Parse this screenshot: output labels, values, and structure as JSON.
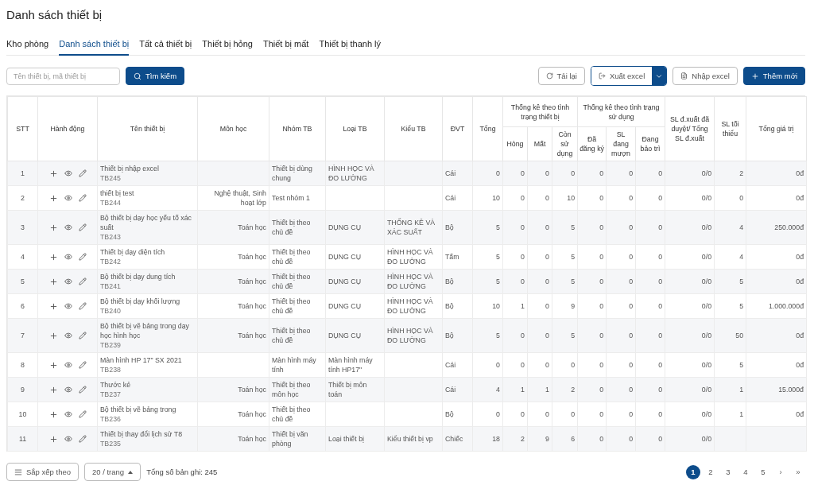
{
  "page_title": "Danh sách thiết bị",
  "tabs": [
    {
      "label": "Kho phòng",
      "selected": false
    },
    {
      "label": "Danh sách thiết bị",
      "selected": true
    },
    {
      "label": "Tất cả thiết bị",
      "selected": false
    },
    {
      "label": "Thiết bị hỏng",
      "selected": false
    },
    {
      "label": "Thiết bị mất",
      "selected": false
    },
    {
      "label": "Thiết bị thanh lý",
      "selected": false
    }
  ],
  "search": {
    "placeholder": "Tên thiết bị, mã thiết bị",
    "button": "Tìm kiếm"
  },
  "actions": {
    "reload": "Tải lại",
    "export": "Xuất excel",
    "import": "Nhập excel",
    "add": "Thêm mới"
  },
  "table": {
    "columns": [
      {
        "label": "STT"
      },
      {
        "label": "Hành động"
      },
      {
        "label": "Tên thiết bị"
      },
      {
        "label": "Môn học"
      },
      {
        "label": "Nhóm TB"
      },
      {
        "label": "Loại TB"
      },
      {
        "label": "Kiểu TB"
      },
      {
        "label": "ĐVT"
      },
      {
        "label": "Tổng"
      },
      {
        "label": "Thống kê theo tình trạng thiết bị",
        "children": [
          {
            "label": "Hỏng"
          },
          {
            "label": "Mất"
          },
          {
            "label": "Còn sử dụng"
          }
        ]
      },
      {
        "label": "Thống kê theo tình trạng sử dụng",
        "children": [
          {
            "label": "Đã đăng ký"
          },
          {
            "label": "SL đang mượn"
          },
          {
            "label": "Đang bảo trì"
          }
        ]
      },
      {
        "label": "SL đ.xuất đã duyệt/ Tổng SL đ.xuất"
      },
      {
        "label": "SL tối thiểu"
      },
      {
        "label": "Tổng giá trị"
      }
    ],
    "rows": [
      {
        "stt": "1",
        "name": "Thiết bị nhập excel",
        "code": "TB245",
        "group": "Thiết bị dùng chung",
        "type": "HÌNH HỌC VÀ ĐO LƯỜNG",
        "unit": "Cái",
        "total": "0",
        "broken": "0",
        "lost": "0",
        "in_use": "0",
        "registered": "0",
        "borrowed": "0",
        "maintenance": "0",
        "proposals": "0/0",
        "min_qty": "2",
        "value": "0đ"
      },
      {
        "stt": "2",
        "name": "thiết bị test",
        "code": "TB244",
        "subject": "Nghệ thuật, Sinh hoạt lớp",
        "group": "Test nhóm 1",
        "unit": "Cái",
        "total": "10",
        "broken": "0",
        "lost": "0",
        "in_use": "10",
        "registered": "0",
        "borrowed": "0",
        "maintenance": "0",
        "proposals": "0/0",
        "min_qty": "0",
        "value": "0đ"
      },
      {
        "stt": "3",
        "name": "Bộ thiết bị dạy học yếu tố xác suất",
        "code": "TB243",
        "subject": "Toán học",
        "group": "Thiết bị theo chủ đề",
        "type": "DỤNG CỤ",
        "style": "THỐNG KÊ VÀ XÁC SUẤT",
        "unit": "Bộ",
        "total": "5",
        "broken": "0",
        "lost": "0",
        "in_use": "5",
        "registered": "0",
        "borrowed": "0",
        "maintenance": "0",
        "proposals": "0/0",
        "min_qty": "4",
        "value": "250.000đ"
      },
      {
        "stt": "4",
        "name": "Thiết bị dạy diện tích",
        "code": "TB242",
        "subject": "Toán học",
        "group": "Thiết bị theo chủ đề",
        "type": "DỤNG CỤ",
        "style": "HÌNH HỌC VÀ ĐO LƯỜNG",
        "unit": "Tấm",
        "total": "5",
        "broken": "0",
        "lost": "0",
        "in_use": "5",
        "registered": "0",
        "borrowed": "0",
        "maintenance": "0",
        "proposals": "0/0",
        "min_qty": "4",
        "value": "0đ"
      },
      {
        "stt": "5",
        "name": "Bộ thiết bị dạy dung tích",
        "code": "TB241",
        "subject": "Toán học",
        "group": "Thiết bị theo chủ đề",
        "type": "DỤNG CỤ",
        "style": "HÌNH HỌC VÀ ĐO LƯỜNG",
        "unit": "Bộ",
        "total": "5",
        "broken": "0",
        "lost": "0",
        "in_use": "5",
        "registered": "0",
        "borrowed": "0",
        "maintenance": "0",
        "proposals": "0/0",
        "min_qty": "5",
        "value": "0đ"
      },
      {
        "stt": "6",
        "name": "Bộ thiết bị dạy khối lượng",
        "code": "TB240",
        "subject": "Toán học",
        "group": "Thiết bị theo chủ đề",
        "type": "DỤNG CỤ",
        "style": "HÌNH HỌC VÀ ĐO LƯỜNG",
        "unit": "Bộ",
        "total": "10",
        "broken": "1",
        "lost": "0",
        "in_use": "9",
        "registered": "0",
        "borrowed": "0",
        "maintenance": "0",
        "proposals": "0/0",
        "min_qty": "5",
        "value": "1.000.000đ"
      },
      {
        "stt": "7",
        "name": "Bộ thiết bị vẽ bảng trong dạy học hình học",
        "code": "TB239",
        "subject": "Toán học",
        "group": "Thiết bị theo chủ đề",
        "type": "DỤNG CỤ",
        "style": "HÌNH HỌC VÀ ĐO LƯỜNG",
        "unit": "Bộ",
        "total": "5",
        "broken": "0",
        "lost": "0",
        "in_use": "5",
        "registered": "0",
        "borrowed": "0",
        "maintenance": "0",
        "proposals": "0/0",
        "min_qty": "50",
        "value": "0đ"
      },
      {
        "stt": "8",
        "name": "Màn hình HP 17\" SX 2021",
        "code": "TB238",
        "group": "Màn hình máy tính",
        "type": "Màn hình máy tính HP17\"",
        "unit": "Cái",
        "total": "0",
        "broken": "0",
        "lost": "0",
        "in_use": "0",
        "registered": "0",
        "borrowed": "0",
        "maintenance": "0",
        "proposals": "0/0",
        "min_qty": "5",
        "value": "0đ"
      },
      {
        "stt": "9",
        "name": "Thước kẻ",
        "code": "TB237",
        "subject": "Toán học",
        "group": "Thiết bị theo môn học",
        "type": "Thiết bị môn toán",
        "unit": "Cái",
        "total": "4",
        "broken": "1",
        "lost": "1",
        "in_use": "2",
        "registered": "0",
        "borrowed": "0",
        "maintenance": "0",
        "proposals": "0/0",
        "min_qty": "1",
        "value": "15.000đ"
      },
      {
        "stt": "10",
        "name": "Bộ thiết bị vẽ bảng trong",
        "code": "TB236",
        "subject": "Toán học",
        "group": "Thiết bị theo chủ đề",
        "unit": "Bộ",
        "total": "0",
        "broken": "0",
        "lost": "0",
        "in_use": "0",
        "registered": "0",
        "borrowed": "0",
        "maintenance": "0",
        "proposals": "0/0",
        "min_qty": "1",
        "value": "0đ"
      },
      {
        "stt": "11",
        "name": "Thiết bị thay đổi lịch sử T8",
        "code": "TB235",
        "subject": "Toán học",
        "group": "Thiết bị văn phòng",
        "type": "Loại thiết bị",
        "style": "Kiểu thiết bị vp",
        "unit": "Chiếc",
        "total": "18",
        "broken": "2",
        "lost": "9",
        "in_use": "6",
        "registered": "0",
        "borrowed": "0",
        "maintenance": "0",
        "proposals": "0/0"
      }
    ]
  },
  "footer": {
    "sort": "Sắp xếp theo",
    "page_size": "20 / trang",
    "total": "Tổng số bản ghi: 245"
  },
  "pagination": [
    {
      "label": "1",
      "selected": true
    },
    {
      "label": "2",
      "selected": false
    },
    {
      "label": "3",
      "selected": false
    },
    {
      "label": "4",
      "selected": false
    },
    {
      "label": "5",
      "selected": false
    },
    {
      "label": "›",
      "selected": false
    },
    {
      "label": "»",
      "selected": false
    }
  ]
}
